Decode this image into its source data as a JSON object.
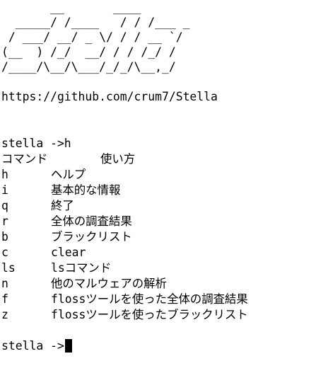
{
  "banner": {
    "ascii_lines": [
      "       __       ____",
      "  _____/ /____   / / /___ _",
      " / ___/ __/ _ \\/ / / __ `/",
      "(__  ) /_/  __/ / / /_/ /",
      "/____/\\__/\\___/_/_/\\__,_/"
    ],
    "url": "https://github.com/crum7/Stella"
  },
  "session": {
    "prompt_command": "stella ->h",
    "final_prompt": "stella ->"
  },
  "help_table": {
    "header_command": "コマンド",
    "header_usage": "使い方",
    "rows": [
      {
        "key": "h",
        "desc": "ヘルプ"
      },
      {
        "key": "i",
        "desc": "基本的な情報"
      },
      {
        "key": "q",
        "desc": "終了"
      },
      {
        "key": "r",
        "desc": "全体の調査結果"
      },
      {
        "key": "b",
        "desc": "ブラックリスト"
      },
      {
        "key": "c",
        "desc": "clear"
      },
      {
        "key": "ls",
        "desc": "lsコマンド"
      },
      {
        "key": "n",
        "desc": "他のマルウェアの解析"
      },
      {
        "key": "f",
        "desc": "flossツールを使った全体の調査結果"
      },
      {
        "key": "z",
        "desc": "flossツールを使ったブラックリスト"
      }
    ]
  }
}
